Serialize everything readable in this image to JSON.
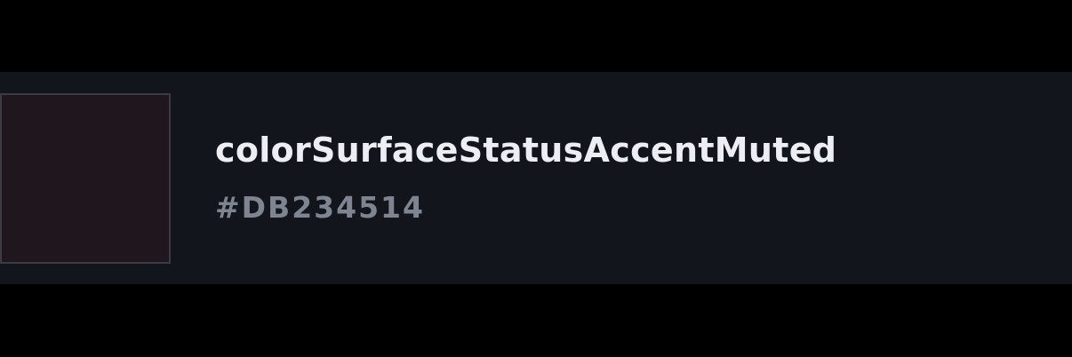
{
  "token": {
    "name": "colorSurfaceStatusAccentMuted",
    "value": "#DB234514"
  },
  "colors": {
    "page_background": "#000000",
    "card_background": "#12151b",
    "swatch_fill": "#1f161e",
    "swatch_border": "#3e3a44",
    "name_text": "#eceef4",
    "value_text": "#7f8590"
  }
}
